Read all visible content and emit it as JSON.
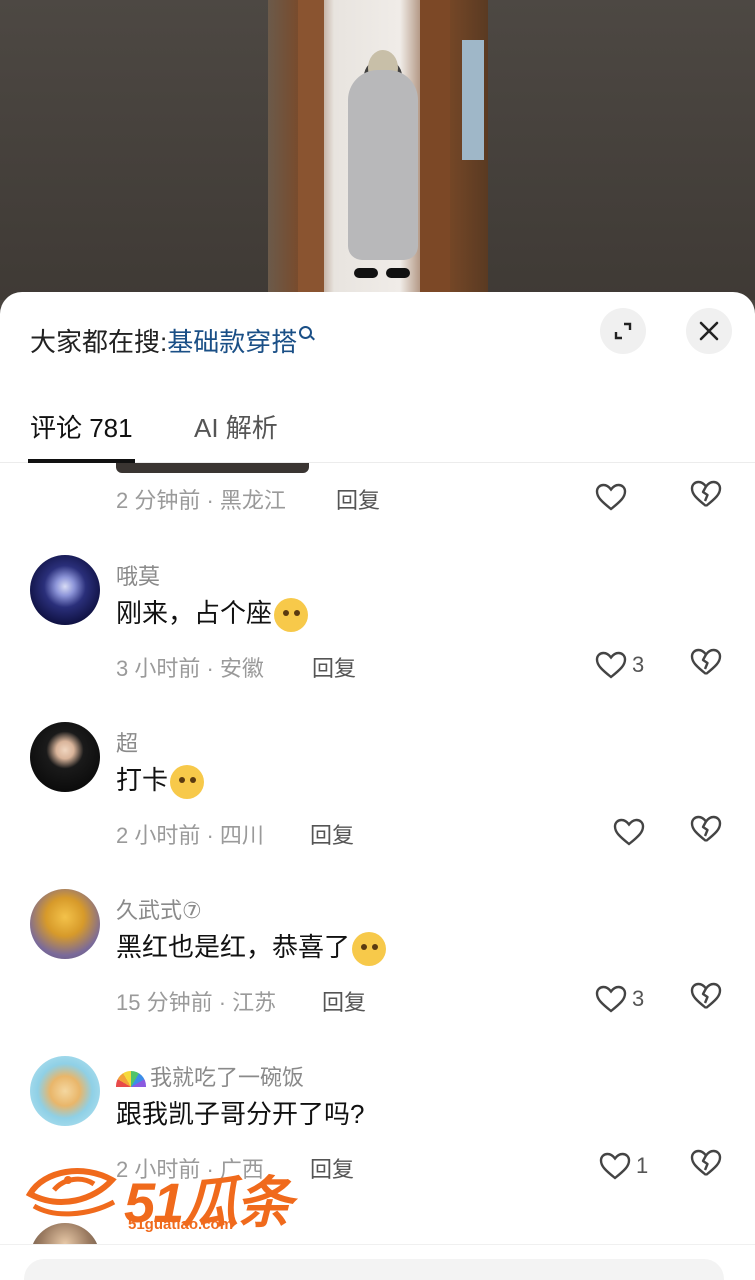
{
  "search_hint": {
    "prefix": "大家都在搜:",
    "keyword": "基础款穿搭"
  },
  "tabs": [
    {
      "label": "评论 781",
      "active": true
    },
    {
      "label": "AI 解析",
      "active": false
    }
  ],
  "partial_comment": {
    "time_location": "2 分钟前 · 黑龙江",
    "reply": "回复"
  },
  "comments": [
    {
      "username": "哦莫",
      "text": "刚来，占个座",
      "emoji": "shy-face-emoji",
      "time_location": "3 小时前 · 安徽",
      "reply": "回复",
      "likes": "3"
    },
    {
      "username": "超",
      "text": "打卡",
      "emoji": "dizzy-face-emoji",
      "time_location": "2 小时前 · 四川",
      "reply": "回复",
      "likes": ""
    },
    {
      "username": "久武式⑦",
      "text": "黑红也是红，恭喜了",
      "emoji": "smirk-face-emoji",
      "time_location": "15 分钟前 · 江苏",
      "reply": "回复",
      "likes": "3"
    },
    {
      "username": "我就吃了一碗饭",
      "text": "跟我凯子哥分开了吗?",
      "emoji": "",
      "time_location": "2 小时前 · 广西",
      "reply": "回复",
      "likes": "1"
    }
  ],
  "watermark": {
    "main": "51瓜条",
    "sub": "51guatiao.com"
  },
  "colors": {
    "accent_link": "#1a4f86",
    "watermark": "#f06a1c"
  }
}
